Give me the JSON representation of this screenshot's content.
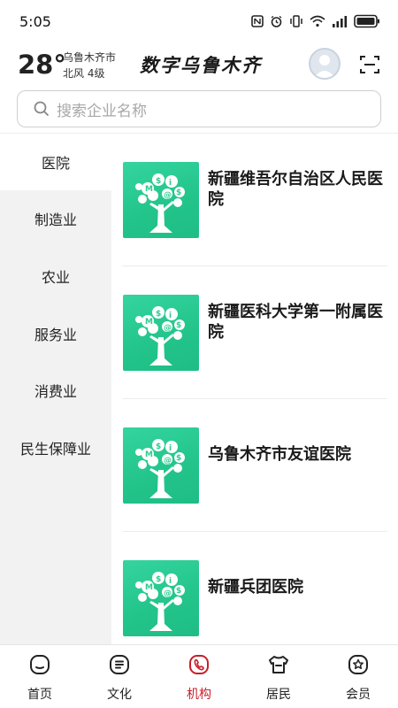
{
  "status_bar": {
    "time": "5:05"
  },
  "weather": {
    "temperature": "28°",
    "city": "乌鲁木齐市",
    "wind": "北风  4级"
  },
  "header": {
    "title": "数字乌鲁木齐"
  },
  "search": {
    "placeholder": "搜索企业名称"
  },
  "categories": [
    {
      "label": "医院",
      "active": true
    },
    {
      "label": "制造业",
      "active": false
    },
    {
      "label": "农业",
      "active": false
    },
    {
      "label": "服务业",
      "active": false
    },
    {
      "label": "消费业",
      "active": false
    },
    {
      "label": "民生保障业",
      "active": false
    }
  ],
  "organizations": [
    {
      "name": "新疆维吾尔自治区人民医院"
    },
    {
      "name": "新疆医科大学第一附属医院"
    },
    {
      "name": "乌鲁木齐市友谊医院"
    },
    {
      "name": "新疆兵团医院"
    }
  ],
  "bottom_nav": [
    {
      "label": "首页",
      "icon": "home-icon",
      "active": false
    },
    {
      "label": "文化",
      "icon": "culture-icon",
      "active": false
    },
    {
      "label": "机构",
      "icon": "institution-icon",
      "active": true
    },
    {
      "label": "居民",
      "icon": "resident-icon",
      "active": false
    },
    {
      "label": "会员",
      "icon": "member-icon",
      "active": false
    }
  ],
  "colors": {
    "accent": "#c81f2a",
    "thumb_green": "#2ccb92",
    "sidebar_bg": "#f2f2f2"
  }
}
